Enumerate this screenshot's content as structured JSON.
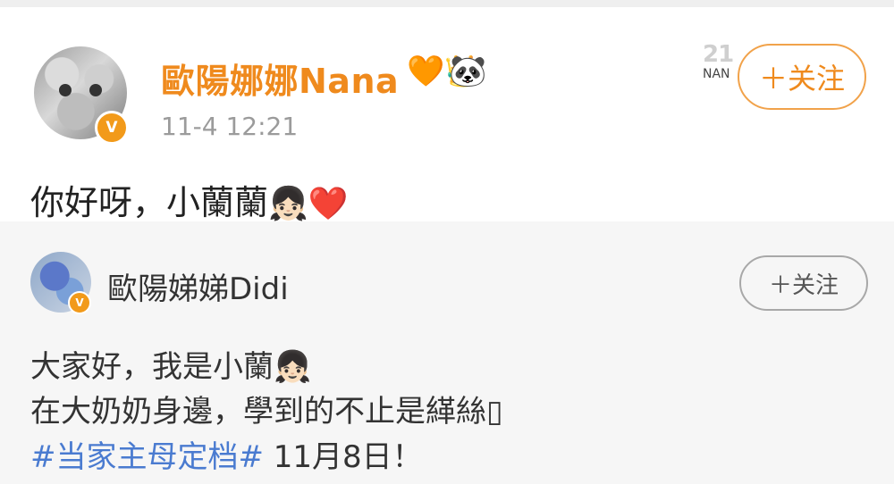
{
  "post": {
    "author": "歐陽娜娜Nana",
    "crown_icon": "🧡👑",
    "panda_icon": "🐼",
    "time": "11-4 12:21",
    "follow_label": "＋关注",
    "watermark_num": "21",
    "watermark_text": "NAN",
    "verified_badge": "V",
    "content_text": "你好呀，小蘭蘭",
    "content_emoji_girl": "👧🏻",
    "content_emoji_heart": "❤️"
  },
  "repost": {
    "author": "歐陽娣娣Didi",
    "verified_badge": "V",
    "follow_label": "＋关注",
    "line1_text": "大家好，我是小蘭",
    "line1_emoji": "👧🏻",
    "line2_text": "在大奶奶身邊，學到的不止是緙絲",
    "line2_glyph": "▯",
    "hashtag": "#当家主母定档#",
    "line3_tail": " 11月8日！"
  },
  "colors": {
    "accent_orange": "#ef8a1d",
    "hashtag_blue": "#4a7bd0",
    "card_bg": "#f6f6f6"
  }
}
